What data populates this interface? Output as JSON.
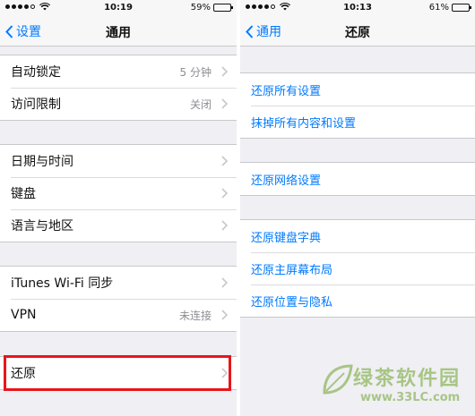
{
  "left": {
    "status": {
      "time": "10:19",
      "battery": "59%",
      "battery_level": 0.59
    },
    "nav": {
      "back_label": "设置",
      "title": "通用"
    },
    "groups": [
      [
        {
          "label": "自动锁定",
          "value": "5 分钟"
        },
        {
          "label": "访问限制",
          "value": "关闭"
        }
      ],
      [
        {
          "label": "日期与时间"
        },
        {
          "label": "键盘"
        },
        {
          "label": "语言与地区"
        }
      ],
      [
        {
          "label": "iTunes Wi-Fi 同步"
        },
        {
          "label": "VPN",
          "value": "未连接"
        }
      ],
      [
        {
          "label": "还原"
        }
      ]
    ]
  },
  "right": {
    "status": {
      "time": "10:13",
      "battery": "61%",
      "battery_level": 0.61
    },
    "nav": {
      "back_label": "通用",
      "title": "还原"
    },
    "groups": [
      [
        {
          "label": "还原所有设置"
        },
        {
          "label": "抹掉所有内容和设置"
        }
      ],
      [
        {
          "label": "还原网络设置"
        }
      ],
      [
        {
          "label": "还原键盘字典"
        },
        {
          "label": "还原主屏幕布局"
        },
        {
          "label": "还原位置与隐私"
        }
      ]
    ]
  },
  "watermark": {
    "text": "绿茶软件园",
    "url": "www.33LC.com"
  },
  "colors": {
    "accent": "#007aff",
    "highlight": "#e8151b",
    "background": "#efeff4"
  }
}
